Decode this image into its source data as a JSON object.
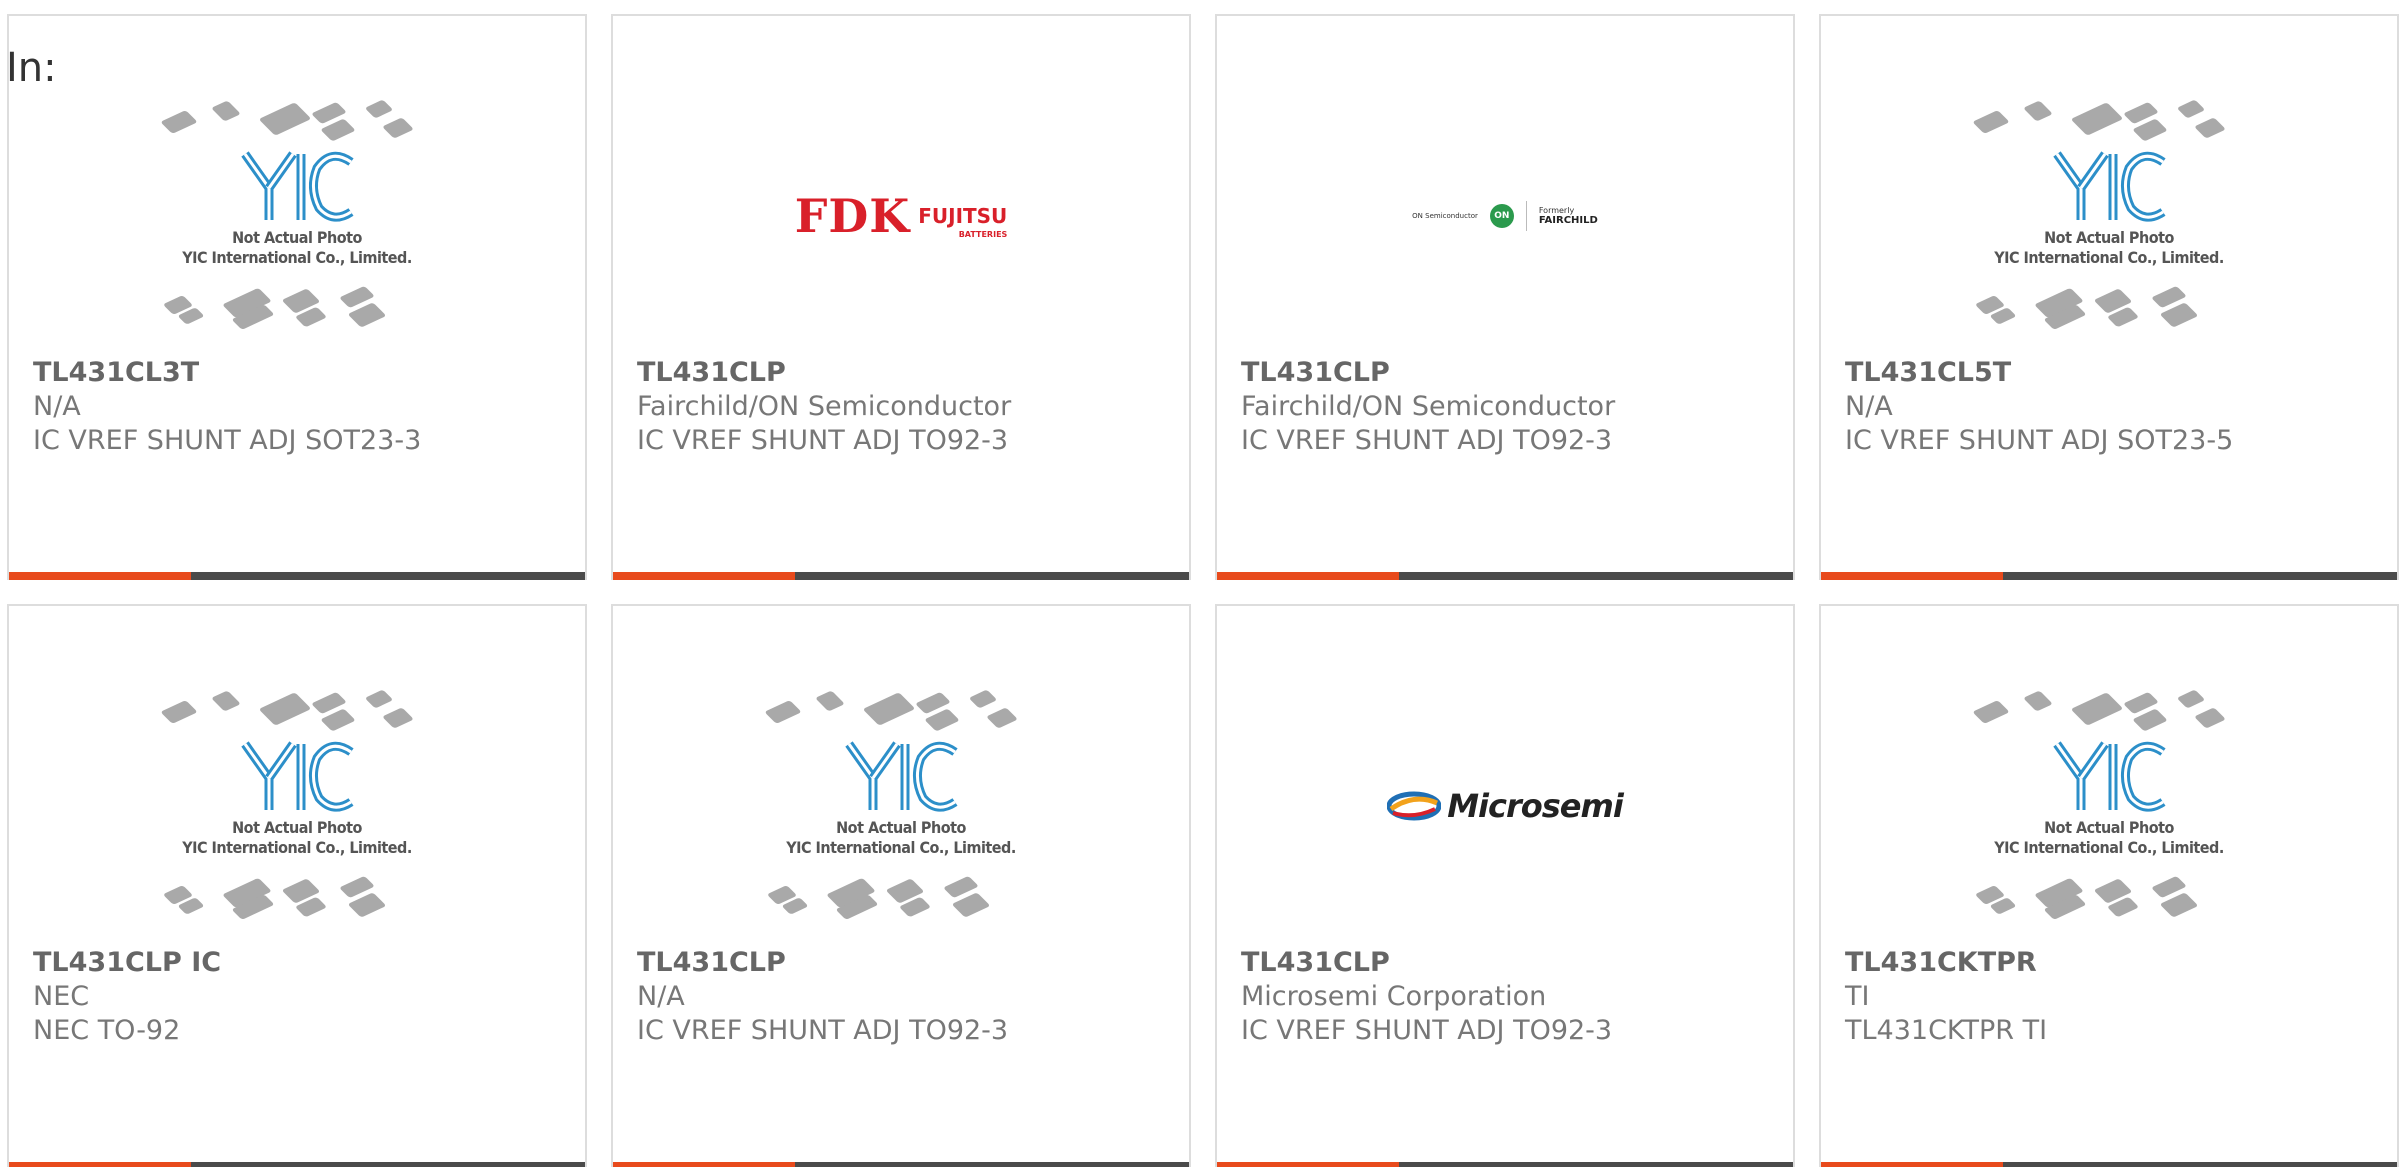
{
  "header": {
    "in_label": "In:"
  },
  "placeholder": {
    "line1": "Not Actual Photo",
    "line2": "YIC International Co., Limited."
  },
  "brands": {
    "fdk": "FDK",
    "fujitsu": "FUJITSU",
    "batteries": "BATTERIES",
    "onsemi_small": "ON Semiconductor",
    "on": "ON",
    "formerly": "Formerly",
    "fairchild": "FAIRCHILD",
    "microsemi": "Microsemi"
  },
  "colors": {
    "accent": "#e84a1c",
    "bar": "#4a4a4a",
    "yic_blue": "#2c8fc9"
  },
  "products": [
    {
      "part": "TL431CL3T",
      "manufacturer": "N/A",
      "description": "IC VREF SHUNT ADJ SOT23-3",
      "image": "yic-placeholder"
    },
    {
      "part": "TL431CLP",
      "manufacturer": "Fairchild/ON Semiconductor",
      "description": "IC VREF SHUNT ADJ TO92-3",
      "image": "fdk-fujitsu-logo"
    },
    {
      "part": "TL431CLP",
      "manufacturer": "Fairchild/ON Semiconductor",
      "description": "IC VREF SHUNT ADJ TO92-3",
      "image": "onsemi-fairchild-logo"
    },
    {
      "part": "TL431CL5T",
      "manufacturer": "N/A",
      "description": "IC VREF SHUNT ADJ SOT23-5",
      "image": "yic-placeholder"
    },
    {
      "part": "TL431CLP IC",
      "manufacturer": "NEC",
      "description": "NEC TO-92",
      "image": "yic-placeholder"
    },
    {
      "part": "TL431CLP",
      "manufacturer": "N/A",
      "description": "IC VREF SHUNT ADJ TO92-3",
      "image": "yic-placeholder"
    },
    {
      "part": "TL431CLP",
      "manufacturer": "Microsemi Corporation",
      "description": "IC VREF SHUNT ADJ TO92-3",
      "image": "microsemi-logo"
    },
    {
      "part": "TL431CKTPR",
      "manufacturer": "TI",
      "description": "TL431CKTPR TI",
      "image": "yic-placeholder"
    }
  ]
}
